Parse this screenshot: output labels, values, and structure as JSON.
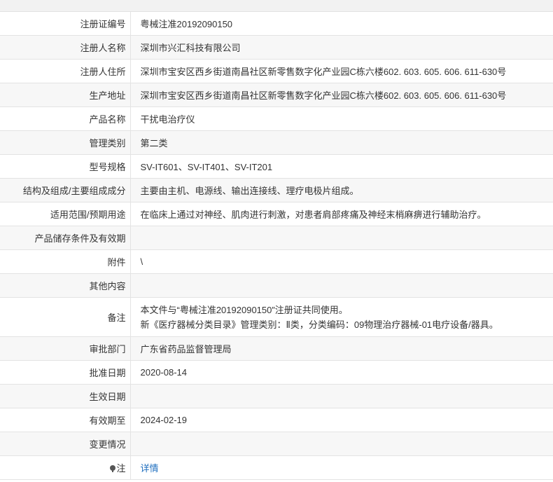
{
  "rows": [
    {
      "label": "注册证编号",
      "value": "粤械注准20192090150"
    },
    {
      "label": "注册人名称",
      "value": "深圳市兴汇科技有限公司"
    },
    {
      "label": "注册人住所",
      "value": "深圳市宝安区西乡街道南昌社区新零售数字化产业园C栋六楼602. 603. 605. 606. 611-630号"
    },
    {
      "label": "生产地址",
      "value": "深圳市宝安区西乡街道南昌社区新零售数字化产业园C栋六楼602. 603. 605. 606. 611-630号"
    },
    {
      "label": "产品名称",
      "value": "干扰电治疗仪"
    },
    {
      "label": "管理类别",
      "value": "第二类"
    },
    {
      "label": "型号规格",
      "value": "SV-IT601、SV-IT401、SV-IT201"
    },
    {
      "label": "结构及组成/主要组成成分",
      "value": "主要由主机、电源线、输出连接线、理疗电极片组成。"
    },
    {
      "label": "适用范围/预期用途",
      "value": "在临床上通过对神经、肌肉进行刺激，对患者肩部疼痛及神经末梢麻痹进行辅助治疗。"
    },
    {
      "label": "产品储存条件及有效期",
      "value": ""
    },
    {
      "label": "附件",
      "value": "\\"
    },
    {
      "label": "其他内容",
      "value": ""
    },
    {
      "label": "备注",
      "line1": "本文件与“粤械注准20192090150”注册证共同使用。",
      "line2": "新《医疗器械分类目录》管理类别：Ⅱ类，分类编码：09物理治疗器械-01电疗设备/器具。"
    },
    {
      "label": "审批部门",
      "value": "广东省药品监督管理局"
    },
    {
      "label": "批准日期",
      "value": "2020-08-14"
    },
    {
      "label": "生效日期",
      "value": ""
    },
    {
      "label": "有效期至",
      "value": "2024-02-19"
    },
    {
      "label": "变更情况",
      "value": ""
    },
    {
      "label": "注",
      "link": "详情",
      "icon": "pin-icon"
    }
  ]
}
